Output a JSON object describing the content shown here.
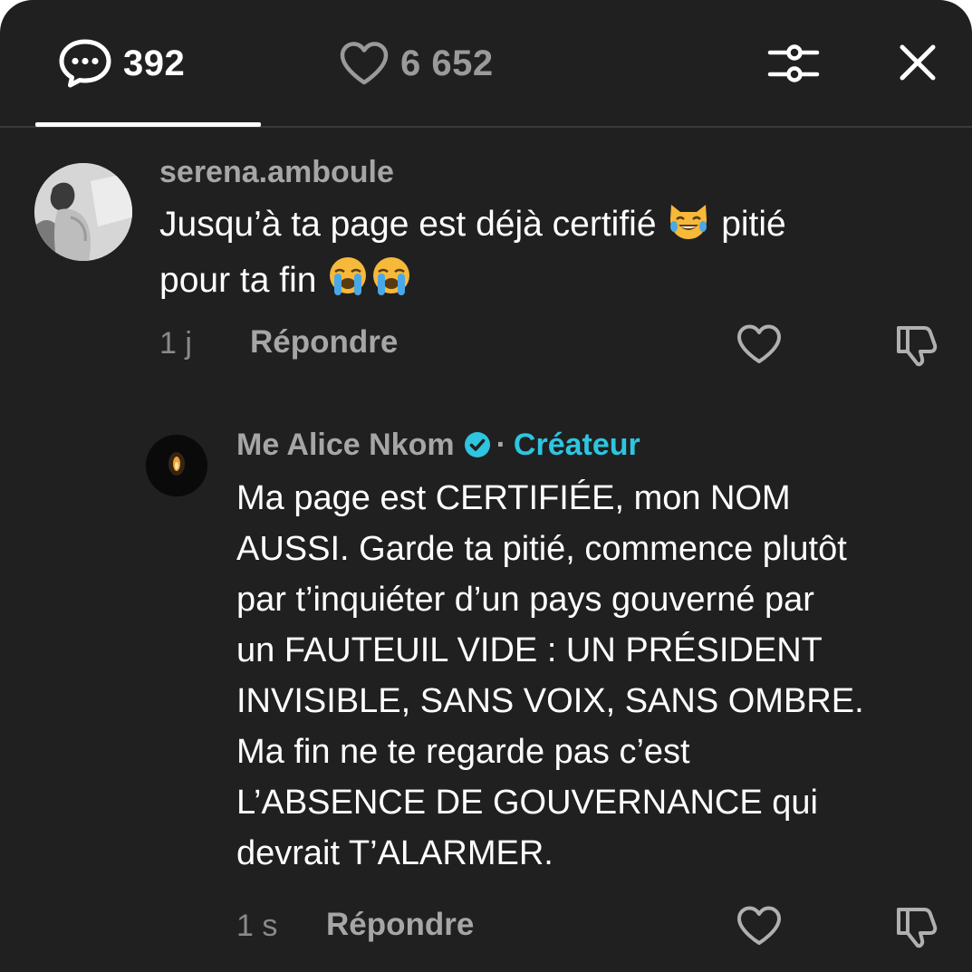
{
  "header": {
    "comments_count": "392",
    "likes_count": "6 652",
    "comments_icon": "comment-bubble-icon",
    "likes_icon": "heart-outline-icon",
    "filter_icon": "sliders-icon",
    "close_icon": "close-icon"
  },
  "colors": {
    "background": "#202020",
    "creator_accent": "#2ec5e0",
    "muted_text": "#a6a6a6"
  },
  "comments": [
    {
      "username": "serena.amboule",
      "text_line1": "Jusqu’à ta page est déjà certifié",
      "text_line1_end": "pitié",
      "text_line2": "pour ta fin",
      "emojis": [
        "cat-tears-of-joy-emoji",
        "loudly-crying-face-emoji",
        "loudly-crying-face-emoji"
      ],
      "time": "1 j",
      "reply_label": "Répondre"
    },
    {
      "username": "Me Alice Nkom",
      "separator": "·",
      "badge": "Créateur",
      "verified_icon": "verified-check-icon",
      "text_lines": [
        "Ma page est CERTIFIÉE, mon NOM",
        "AUSSI. Garde ta pitié, commence plutôt",
        "par t’inquiéter d’un pays gouverné par",
        "un FAUTEUIL VIDE : UN PRÉSIDENT",
        "INVISIBLE, SANS VOIX, SANS OMBRE.",
        "Ma fin ne te regarde pas c’est",
        "L’ABSENCE DE GOUVERNANCE qui",
        "devrait T’ALARMER."
      ],
      "time": "1 s",
      "reply_label": "Répondre"
    }
  ]
}
